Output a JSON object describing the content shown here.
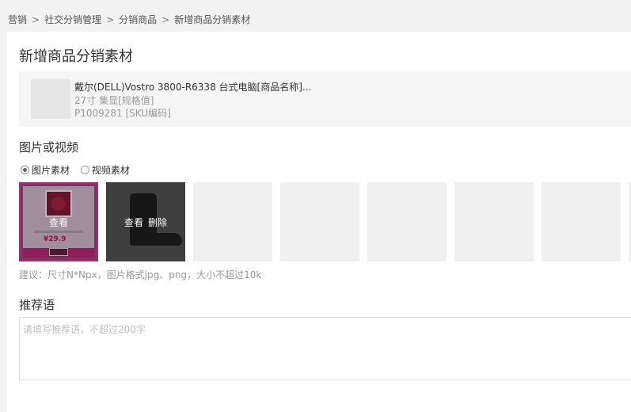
{
  "breadcrumb": {
    "items": [
      "营销",
      "社交分销管理",
      "分销商品",
      "新增商品分销素材"
    ],
    "separator": ">"
  },
  "page": {
    "title": "新增商品分销素材"
  },
  "product": {
    "name": "戴尔(DELL)Vostro 3800-R6338 台式电脑[商品名称]...",
    "spec": "27寸 集显[规格值]",
    "sku": "P1009281 [SKU编码]"
  },
  "media": {
    "title": "图片或视频",
    "options": [
      {
        "label": "图片素材",
        "checked": true
      },
      {
        "label": "视频素材",
        "checked": false
      }
    ],
    "slots": [
      {
        "type": "promo-image",
        "actions": [
          "查看"
        ]
      },
      {
        "type": "boot-image",
        "actions": [
          "查看",
          "删除"
        ]
      },
      {
        "type": "empty"
      },
      {
        "type": "empty"
      },
      {
        "type": "empty"
      },
      {
        "type": "empty"
      },
      {
        "type": "empty"
      },
      {
        "type": "empty"
      }
    ],
    "hint": "建议：尺寸N*Npx，图片格式jpg、png，大小不超过10k",
    "promo_price": "¥29.9"
  },
  "recommend": {
    "title": "推荐语",
    "placeholder": "请填写推荐语，不超过200字",
    "value": ""
  },
  "colors": {
    "page_bg": "#f2f2f2",
    "panel_bg": "#ffffff",
    "card_bg": "#f5f5f5",
    "promo_border": "#b3256e",
    "hint_text": "#999999"
  }
}
